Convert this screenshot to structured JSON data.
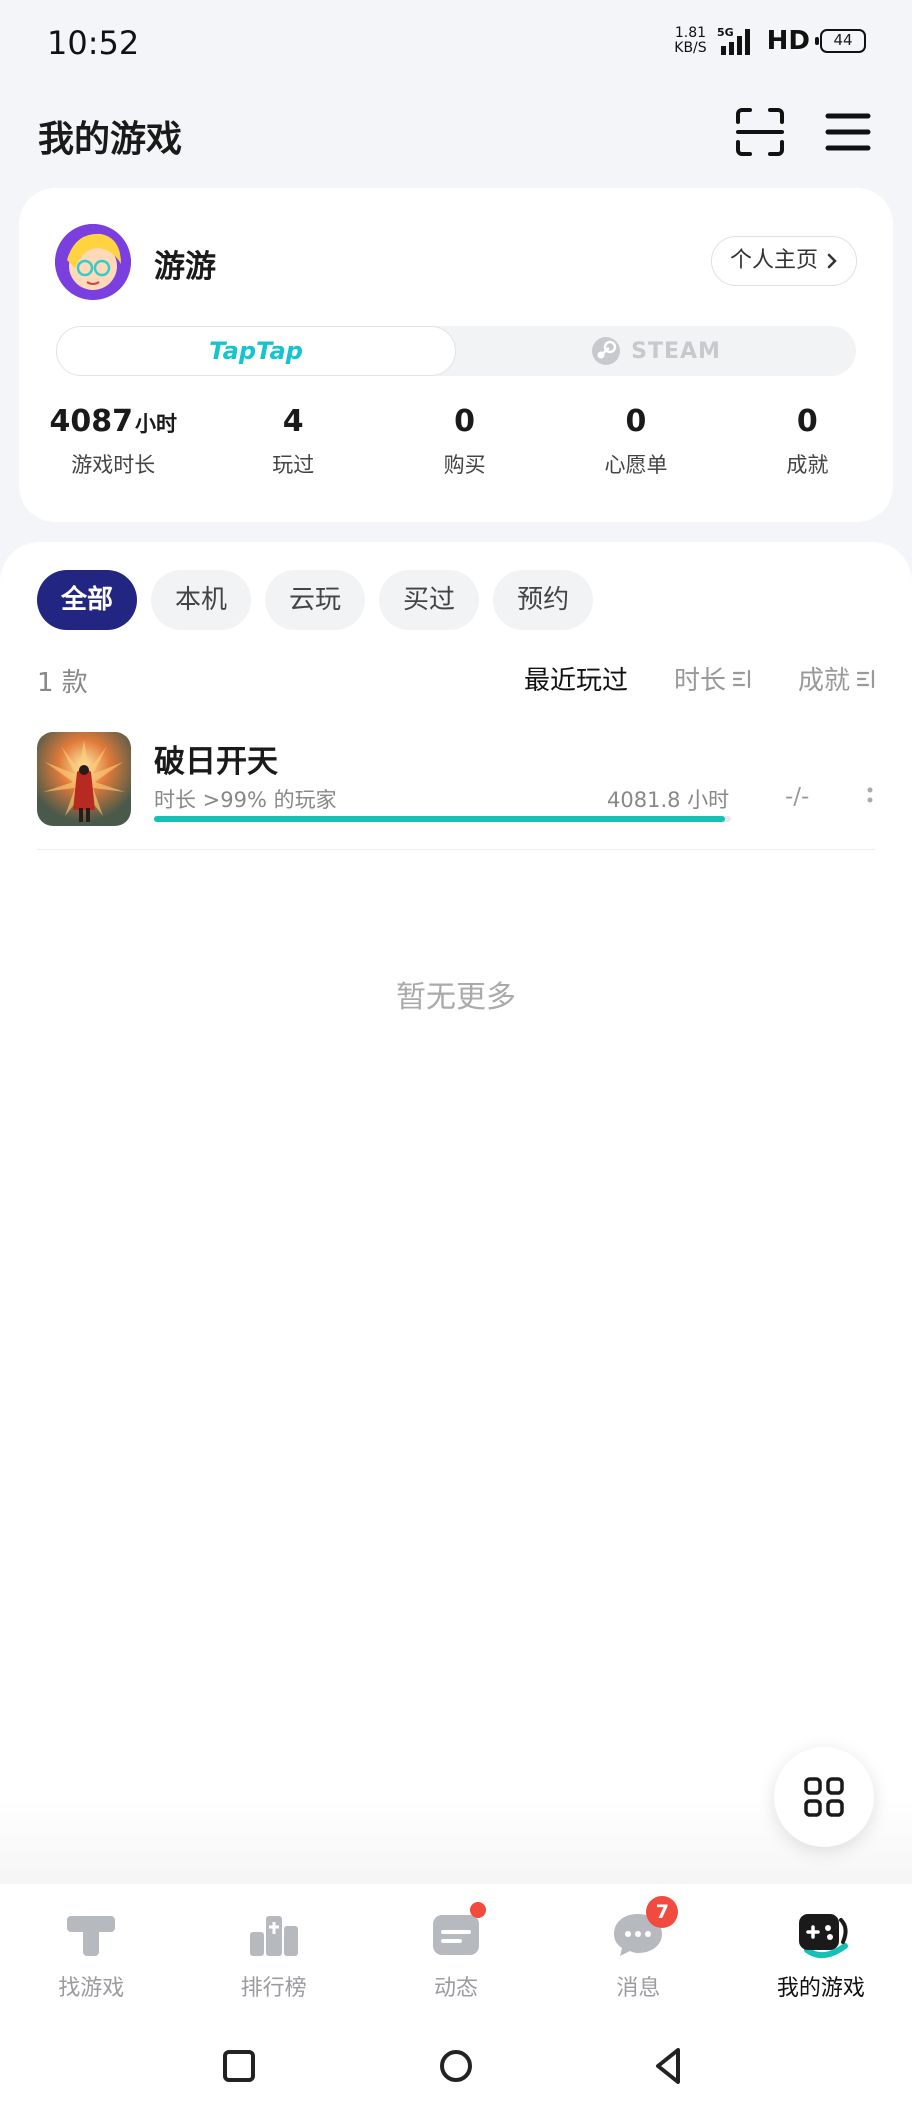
{
  "status_bar": {
    "time": "10:52",
    "net_speed_value": "1.81",
    "net_speed_unit": "KB/S",
    "network": "5G",
    "hd": "HD",
    "battery": "44"
  },
  "header": {
    "title": "我的游戏"
  },
  "profile": {
    "username": "游游",
    "profile_link": "个人主页",
    "platforms": {
      "taptap": "TapTap",
      "steam": "STEAM"
    },
    "stats": [
      {
        "value": "4087",
        "unit": "小时",
        "label": "游戏时长"
      },
      {
        "value": "4",
        "label": "玩过"
      },
      {
        "value": "0",
        "label": "购买"
      },
      {
        "value": "0",
        "label": "心愿单"
      },
      {
        "value": "0",
        "label": "成就"
      }
    ]
  },
  "filters": [
    "全部",
    "本机",
    "云玩",
    "买过",
    "预约"
  ],
  "active_filter": "全部",
  "list": {
    "count": "1 款",
    "sort": {
      "recent": "最近玩过",
      "duration": "时长",
      "achievements": "成就"
    },
    "games": [
      {
        "name": "破日开天",
        "rank_text": "时长 >99% 的玩家",
        "hours_text": "4081.8 小时",
        "progress_fraction": 0.99,
        "achievements": "-/-"
      }
    ],
    "no_more": "暂无更多"
  },
  "bottom_nav": [
    {
      "label": "找游戏",
      "icon": "find-games-icon"
    },
    {
      "label": "排行榜",
      "icon": "ranking-icon"
    },
    {
      "label": "动态",
      "icon": "moments-icon",
      "dot": true
    },
    {
      "label": "消息",
      "icon": "messages-icon",
      "badge": "7"
    },
    {
      "label": "我的游戏",
      "icon": "my-games-icon",
      "active": true
    }
  ],
  "colors": {
    "accent_teal": "#15c1b4",
    "active_chip": "#222581",
    "badge_red": "#f04b3e"
  }
}
